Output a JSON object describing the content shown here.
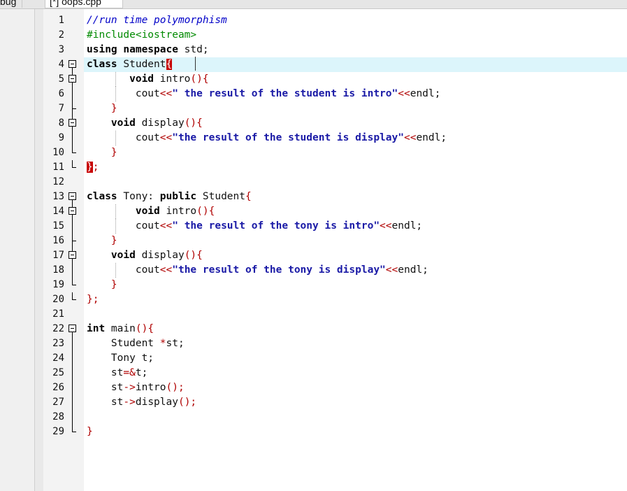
{
  "window": {
    "menu_fragment": "bug",
    "tab_label": "[*] oops.cpp"
  },
  "editor": {
    "current_line": 4,
    "lines": [
      {
        "n": "1",
        "tokens": [
          {
            "t": "//run time polymorphism",
            "c": "cm"
          }
        ]
      },
      {
        "n": "2",
        "tokens": [
          {
            "t": "#include<iostream>",
            "c": "pp"
          }
        ]
      },
      {
        "n": "3",
        "tokens": [
          {
            "t": "using namespace",
            "c": "kw"
          },
          {
            "t": " std;",
            "c": ""
          }
        ]
      },
      {
        "n": "4",
        "tokens": [
          {
            "t": "class",
            "c": "kw"
          },
          {
            "t": " Student",
            "c": ""
          },
          {
            "t": "{",
            "c": "bm"
          }
        ]
      },
      {
        "n": "5",
        "tokens": [
          {
            "t": "       ",
            "c": ""
          },
          {
            "t": "void",
            "c": "kw"
          },
          {
            "t": " intro",
            "c": ""
          },
          {
            "t": "(){",
            "c": "br"
          }
        ]
      },
      {
        "n": "6",
        "tokens": [
          {
            "t": "        cout",
            "c": ""
          },
          {
            "t": "<<",
            "c": "op"
          },
          {
            "t": "\" the result of the student is intro\"",
            "c": "str"
          },
          {
            "t": "<<",
            "c": "op"
          },
          {
            "t": "endl;",
            "c": ""
          }
        ]
      },
      {
        "n": "7",
        "tokens": [
          {
            "t": "    ",
            "c": ""
          },
          {
            "t": "}",
            "c": "br"
          }
        ]
      },
      {
        "n": "8",
        "tokens": [
          {
            "t": "    ",
            "c": ""
          },
          {
            "t": "void",
            "c": "kw"
          },
          {
            "t": " display",
            "c": ""
          },
          {
            "t": "(){",
            "c": "br"
          }
        ]
      },
      {
        "n": "9",
        "tokens": [
          {
            "t": "        cout",
            "c": ""
          },
          {
            "t": "<<",
            "c": "op"
          },
          {
            "t": "\"the result of the student is display\"",
            "c": "str"
          },
          {
            "t": "<<",
            "c": "op"
          },
          {
            "t": "endl;",
            "c": ""
          }
        ]
      },
      {
        "n": "10",
        "tokens": [
          {
            "t": "    ",
            "c": ""
          },
          {
            "t": "}",
            "c": "br"
          }
        ]
      },
      {
        "n": "11",
        "tokens": [
          {
            "t": "}",
            "c": "bm"
          },
          {
            "t": ";",
            "c": "br"
          }
        ]
      },
      {
        "n": "12",
        "tokens": []
      },
      {
        "n": "13",
        "tokens": [
          {
            "t": "class",
            "c": "kw"
          },
          {
            "t": " Tony: ",
            "c": ""
          },
          {
            "t": "public",
            "c": "kw"
          },
          {
            "t": " Student",
            "c": ""
          },
          {
            "t": "{",
            "c": "br"
          }
        ]
      },
      {
        "n": "14",
        "tokens": [
          {
            "t": "        ",
            "c": ""
          },
          {
            "t": "void",
            "c": "kw"
          },
          {
            "t": " intro",
            "c": ""
          },
          {
            "t": "(){",
            "c": "br"
          }
        ]
      },
      {
        "n": "15",
        "tokens": [
          {
            "t": "        cout",
            "c": ""
          },
          {
            "t": "<<",
            "c": "op"
          },
          {
            "t": "\" the result of the tony is intro\"",
            "c": "str"
          },
          {
            "t": "<<",
            "c": "op"
          },
          {
            "t": "endl;",
            "c": ""
          }
        ]
      },
      {
        "n": "16",
        "tokens": [
          {
            "t": "    ",
            "c": ""
          },
          {
            "t": "}",
            "c": "br"
          }
        ]
      },
      {
        "n": "17",
        "tokens": [
          {
            "t": "    ",
            "c": ""
          },
          {
            "t": "void",
            "c": "kw"
          },
          {
            "t": " display",
            "c": ""
          },
          {
            "t": "(){",
            "c": "br"
          }
        ]
      },
      {
        "n": "18",
        "tokens": [
          {
            "t": "        cout",
            "c": ""
          },
          {
            "t": "<<",
            "c": "op"
          },
          {
            "t": "\"the result of the tony is display\"",
            "c": "str"
          },
          {
            "t": "<<",
            "c": "op"
          },
          {
            "t": "endl;",
            "c": ""
          }
        ]
      },
      {
        "n": "19",
        "tokens": [
          {
            "t": "    ",
            "c": ""
          },
          {
            "t": "}",
            "c": "br"
          }
        ]
      },
      {
        "n": "20",
        "tokens": [
          {
            "t": "}",
            "c": "br"
          },
          {
            "t": ";",
            "c": "br"
          }
        ]
      },
      {
        "n": "21",
        "tokens": []
      },
      {
        "n": "22",
        "tokens": [
          {
            "t": "int",
            "c": "kw"
          },
          {
            "t": " main",
            "c": ""
          },
          {
            "t": "(){",
            "c": "br"
          }
        ]
      },
      {
        "n": "23",
        "tokens": [
          {
            "t": "    Student ",
            "c": ""
          },
          {
            "t": "*",
            "c": "op"
          },
          {
            "t": "st;",
            "c": ""
          }
        ]
      },
      {
        "n": "24",
        "tokens": [
          {
            "t": "    Tony t;",
            "c": ""
          }
        ]
      },
      {
        "n": "25",
        "tokens": [
          {
            "t": "    st",
            "c": ""
          },
          {
            "t": "=&",
            "c": "op"
          },
          {
            "t": "t;",
            "c": ""
          }
        ]
      },
      {
        "n": "26",
        "tokens": [
          {
            "t": "    st",
            "c": ""
          },
          {
            "t": "->",
            "c": "op"
          },
          {
            "t": "intro",
            "c": ""
          },
          {
            "t": "();",
            "c": "br"
          }
        ]
      },
      {
        "n": "27",
        "tokens": [
          {
            "t": "    st",
            "c": ""
          },
          {
            "t": "->",
            "c": "op"
          },
          {
            "t": "display",
            "c": ""
          },
          {
            "t": "();",
            "c": "br"
          }
        ]
      },
      {
        "n": "28",
        "tokens": []
      },
      {
        "n": "29",
        "tokens": [
          {
            "t": "}",
            "c": "br"
          }
        ]
      }
    ]
  }
}
